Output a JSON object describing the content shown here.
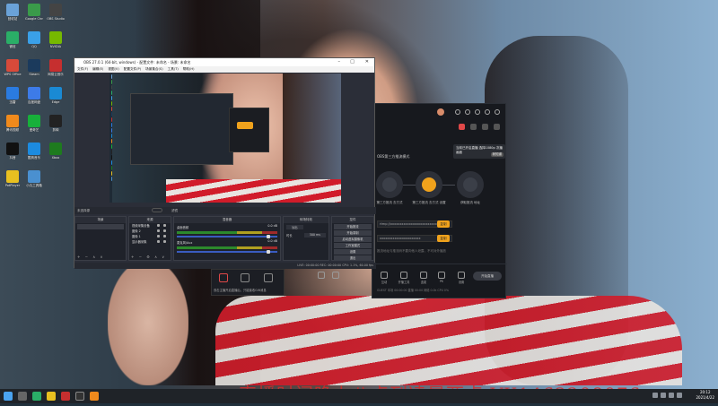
{
  "desktop": {
    "icons": [
      {
        "label": "回收站",
        "color": "#6aa2d8"
      },
      {
        "label": "Google Chrome",
        "color": "#3a9b4a"
      },
      {
        "label": "OBS Studio",
        "color": "#444444"
      },
      {
        "label": "微信",
        "color": "#2aae67"
      },
      {
        "label": "QQ",
        "color": "#3aa0e8"
      },
      {
        "label": "NVIDIA",
        "color": "#76b900"
      },
      {
        "label": "WPS Office",
        "color": "#d84a3a"
      },
      {
        "label": "Steam",
        "color": "#1b3a5c"
      },
      {
        "label": "网易云音乐",
        "color": "#c62f2f"
      },
      {
        "label": "迅雷",
        "color": "#2a7be0"
      },
      {
        "label": "百度网盘",
        "color": "#3d7be8"
      },
      {
        "label": "Edge",
        "color": "#1a8ad4"
      },
      {
        "label": "腾讯视频",
        "color": "#f08a1c"
      },
      {
        "label": "爱奇艺",
        "color": "#17b03a"
      },
      {
        "label": "剪映",
        "color": "#222222"
      },
      {
        "label": "抖音",
        "color": "#111111"
      },
      {
        "label": "酷狗音乐",
        "color": "#1c8be0"
      },
      {
        "label": "Xbox",
        "color": "#1e7b1e"
      },
      {
        "label": "PotPlayer",
        "color": "#e8c020"
      },
      {
        "label": "小丸工具箱",
        "color": "#4a90d0"
      }
    ]
  },
  "watermark": "直播时间晚上八点到凌晨两点 VX1462208076",
  "taskbar": {
    "time": "20:12",
    "date": "2021/4/22"
  },
  "app": {
    "tooltip_text": "当前已开启直播 选择1080p 次播画面",
    "tooltip_button": "我知道",
    "mode_title": "OBS第三方推流模式",
    "modes": [
      {
        "label": "第三方推流 去方式",
        "selected": false
      },
      {
        "label": "第三方推流 去方式 设置",
        "selected": true
      },
      {
        "label": "获取推流 地址",
        "selected": false
      }
    ],
    "mode_selected_caption": "一键开播",
    "server_field": "rtmp://xxxxxxxxxxxxxxxxxxxxxxxxxxxxxxx",
    "key_field": "xxxxxxxxxxxxxxxxxxxxxx",
    "copy_label": "复制",
    "hint": "推流地址与推流码不要向他人泄露，不可对外播放",
    "bottom_items": [
      "开始直播",
      "直播间",
      "开播设置",
      "互动",
      "开播工具",
      "连麦",
      "PK",
      "贡献榜",
      "设置"
    ],
    "go_live": "开始直播",
    "status_line": "GUEST  本场 00:00:00  直播 00:00  网络 0.0k  CPU 0%"
  },
  "obs": {
    "title": "OBS 27.0.1 (64-bit, windows) - 配置文件: 未命名 - 场景: 未命名",
    "menu": [
      "文件(F)",
      "编辑(E)",
      "视图(V)",
      "配置文件(P)",
      "场景集合(S)",
      "工具(T)",
      "帮助(H)"
    ],
    "preview_bar": "未选择源",
    "properties_button": "属性",
    "filters_button": "滤镜",
    "docks": {
      "scenes": "场景",
      "sources": "来源",
      "mixer": "混音器",
      "transitions": "转场特效",
      "controls": "控件"
    },
    "sources": [
      "视频采集设备",
      "图像 2",
      "图像 1",
      "显示器采集"
    ],
    "mixer_channels": [
      {
        "name": "桌面音频",
        "db": "0.0 dB"
      },
      {
        "name": "麦克风/Aux",
        "db": "0.0 dB"
      }
    ],
    "transition": {
      "type": "淡出",
      "duration_label": "时长",
      "duration": "300 ms"
    },
    "controls": [
      "开始推流",
      "开始录制",
      "启动虚拟摄像机",
      "工作室模式",
      "设置",
      "退出"
    ],
    "status": "LIVE: 00:00:00   REC: 00:00:00   CPU: 1.1%, 60.00 fps"
  },
  "popup": {
    "message": "双击主播开启直播后，只能接收Gift消息"
  }
}
